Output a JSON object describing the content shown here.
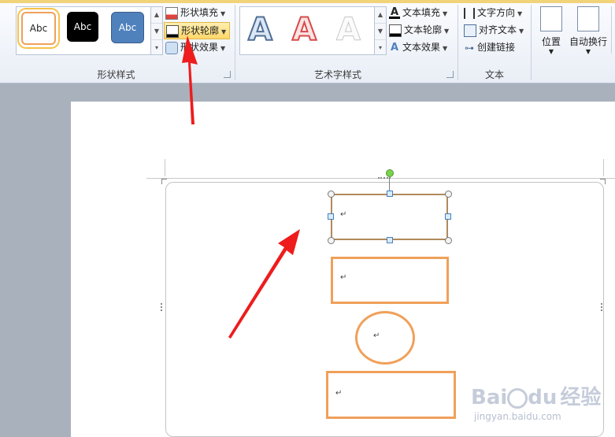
{
  "ribbon": {
    "shape_styles": {
      "label": "形状样式",
      "samples": [
        "Abc",
        "Abc",
        "Abc"
      ],
      "commands": {
        "fill": "形状填充",
        "outline": "形状轮廓",
        "effects": "形状效果"
      }
    },
    "art_styles": {
      "label": "艺术字样式",
      "letters": [
        "A",
        "A",
        "A"
      ],
      "commands": {
        "text_fill": "文本填充",
        "text_outline": "文本轮廓",
        "text_effects": "文本效果"
      }
    },
    "text_group": {
      "label": "文本",
      "commands": {
        "direction": "文字方向",
        "align": "对齐文本",
        "link": "创建链接"
      }
    },
    "arrange": {
      "position": "位置",
      "wrap": "自动换行"
    }
  },
  "document": {
    "paragraph_mark": "↵"
  },
  "watermark": {
    "brand": "Bai",
    "brand2": "du",
    "site_cn": "经验",
    "url": "jingyan.baidu.com"
  },
  "colors": {
    "shape_outline": "#f0a05a",
    "arrow": "#ee1c1c",
    "ribbon_bg": "#eef2f8"
  }
}
